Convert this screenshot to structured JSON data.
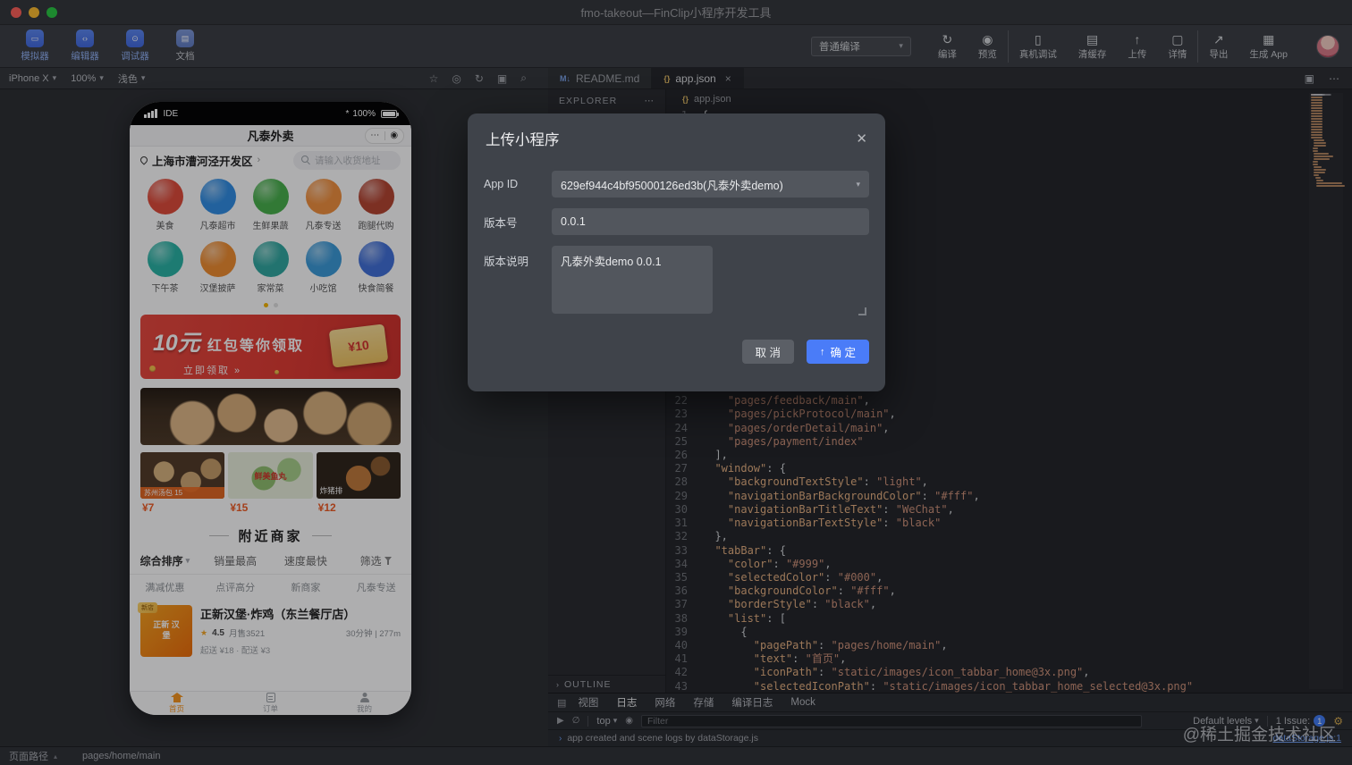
{
  "window_title": "fmo-takeout—FinClip小程序开发工具",
  "toolbar": {
    "apps": [
      {
        "name": "simulator",
        "label": "模拟器"
      },
      {
        "name": "editor",
        "label": "编辑器"
      },
      {
        "name": "debugger",
        "label": "调试器"
      },
      {
        "name": "docs",
        "label": "文档"
      }
    ],
    "compile_mode": "普通编译",
    "actions": [
      {
        "name": "compile",
        "label": "编译",
        "icon": "compile-icon"
      },
      {
        "name": "preview",
        "label": "预览",
        "icon": "preview-icon"
      },
      {
        "name": "remote-debug",
        "label": "真机调试",
        "icon": "phone-icon"
      },
      {
        "name": "clear-cache",
        "label": "清缓存",
        "icon": "cache-icon"
      },
      {
        "name": "upload",
        "label": "上传",
        "icon": "upload-icon"
      },
      {
        "name": "details",
        "label": "详情",
        "icon": "details-icon"
      },
      {
        "name": "export",
        "label": "导出",
        "icon": "export-icon"
      },
      {
        "name": "generate-app",
        "label": "生成 App",
        "icon": "generate-app-icon"
      }
    ]
  },
  "device_bar": {
    "device": "iPhone X",
    "zoom": "100%",
    "theme": "浅色"
  },
  "sim_toolbar_icons": [
    "star-icon",
    "location-icon",
    "refresh-icon",
    "duplicate-icon",
    "search-icon"
  ],
  "explorer": {
    "title": "EXPLORER",
    "outline": "OUTLINE"
  },
  "editor": {
    "tabs": [
      {
        "label": "README.md",
        "active": false
      },
      {
        "label": "app.json",
        "active": true
      }
    ],
    "breadcrumb": "app.json",
    "total_lines": 43,
    "visible_lines": [
      {
        "n": 1,
        "t": "{"
      },
      {
        "n": 22,
        "t": "    \"pages/feedback/main\","
      },
      {
        "n": 23,
        "t": "    \"pages/pickProtocol/main\","
      },
      {
        "n": 24,
        "t": "    \"pages/orderDetail/main\","
      },
      {
        "n": 25,
        "t": "    \"pages/payment/index\""
      },
      {
        "n": 26,
        "t": "  ],"
      },
      {
        "n": 27,
        "t": "  \"window\": {"
      },
      {
        "n": 28,
        "t": "    \"backgroundTextStyle\": \"light\","
      },
      {
        "n": 29,
        "t": "    \"navigationBarBackgroundColor\": \"#fff\","
      },
      {
        "n": 30,
        "t": "    \"navigationBarTitleText\": \"WeChat\","
      },
      {
        "n": 31,
        "t": "    \"navigationBarTextStyle\": \"black\""
      },
      {
        "n": 32,
        "t": "  },"
      },
      {
        "n": 33,
        "t": "  \"tabBar\": {"
      },
      {
        "n": 34,
        "t": "    \"color\": \"#999\","
      },
      {
        "n": 35,
        "t": "    \"selectedColor\": \"#000\","
      },
      {
        "n": 36,
        "t": "    \"backgroundColor\": \"#fff\","
      },
      {
        "n": 37,
        "t": "    \"borderStyle\": \"black\","
      },
      {
        "n": 38,
        "t": "    \"list\": ["
      },
      {
        "n": 39,
        "t": "      {"
      },
      {
        "n": 40,
        "t": "        \"pagePath\": \"pages/home/main\","
      },
      {
        "n": 41,
        "t": "        \"text\": \"首页\","
      },
      {
        "n": 42,
        "t": "        \"iconPath\": \"static/images/icon_tabbar_home@3x.png\","
      },
      {
        "n": 43,
        "t": "        \"selectedIconPath\": \"static/images/icon_tabbar_home_selected@3x.png\""
      }
    ]
  },
  "panel": {
    "tabs": [
      "视图",
      "日志",
      "网络",
      "存储",
      "编译日志",
      "Mock"
    ],
    "active_tab": "日志",
    "top_context": "top",
    "filter_placeholder": "Filter",
    "default_levels": "Default levels",
    "issues_label": "1 Issue:",
    "issues_count": "1",
    "log": {
      "text": "app created and scene logs by dataStorage.js",
      "source": "dataStorage.js:1"
    }
  },
  "statusbar": {
    "label": "页面路径",
    "path": "pages/home/main"
  },
  "watermark": "@稀土掘金技术社区",
  "modal": {
    "title": "上传小程序",
    "app_id_label": "App ID",
    "app_id_value": "629ef944c4bf95000126ed3b(凡泰外卖demo)",
    "version_label": "版本号",
    "version_value": "0.0.1",
    "desc_label": "版本说明",
    "desc_value": "凡泰外卖demo 0.0.1",
    "cancel": "取 消",
    "confirm": "确 定",
    "confirm_color": "#4a7cf8"
  },
  "simulator": {
    "status": {
      "carrier": "IDE",
      "battery": "100%"
    },
    "nav_title": "凡泰外卖",
    "address": "上海市漕河泾开发区",
    "search_placeholder": "请输入收货地址",
    "categories": [
      {
        "label": "美食",
        "color": "#e04a38"
      },
      {
        "label": "凡泰超市",
        "color": "#2f8de4"
      },
      {
        "label": "生鲜果蔬",
        "color": "#46b04a"
      },
      {
        "label": "凡泰专送",
        "color": "#f2903d"
      },
      {
        "label": "跑腿代购",
        "color": "#b5432f"
      },
      {
        "label": "下午茶",
        "color": "#27b3a5"
      },
      {
        "label": "汉堡披萨",
        "color": "#f08c2e"
      },
      {
        "label": "家常菜",
        "color": "#2fa8a0"
      },
      {
        "label": "小吃馆",
        "color": "#3a9ad9"
      },
      {
        "label": "快食简餐",
        "color": "#3f6fd8"
      }
    ],
    "banner": {
      "amount": "10元",
      "title": "红包等你领取",
      "cta": "立即领取 »",
      "coupon": "¥10"
    },
    "products": [
      {
        "tag": "苏州汤包 15",
        "price": "¥7"
      },
      {
        "tag": "鲜美鱼丸",
        "price": "¥15"
      },
      {
        "tag": "炸猪排",
        "price": "¥12"
      }
    ],
    "section_title": "附近商家",
    "filters": [
      "综合排序",
      "销量最高",
      "速度最快",
      "筛选"
    ],
    "tags": [
      "满减优惠",
      "点评高分",
      "新商家",
      "凡泰专送"
    ],
    "restaurant": {
      "badge": "新店",
      "logo_text": "正新 汉堡",
      "name": "正新汉堡·炸鸡（东兰餐厅店）",
      "rating": "4.5",
      "sales": "月售3521",
      "eta": "30分钟 | 277m",
      "delivery": "起送 ¥18 · 配送 ¥3"
    },
    "tabbar": [
      {
        "label": "首页",
        "active": true
      },
      {
        "label": "订单",
        "active": false
      },
      {
        "label": "我的",
        "active": false
      }
    ]
  }
}
